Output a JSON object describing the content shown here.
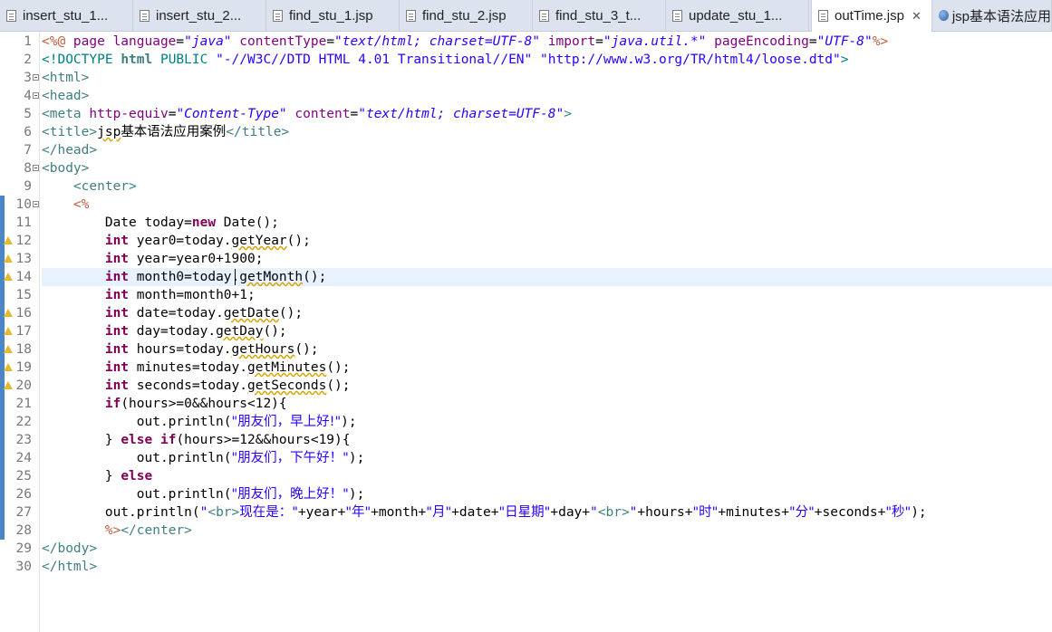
{
  "tabs": [
    {
      "label": "insert_stu_1...",
      "active": false,
      "icon": "file-icon"
    },
    {
      "label": "insert_stu_2...",
      "active": false,
      "icon": "file-icon"
    },
    {
      "label": "find_stu_1.jsp",
      "active": false,
      "icon": "file-icon"
    },
    {
      "label": "find_stu_2.jsp",
      "active": false,
      "icon": "file-icon"
    },
    {
      "label": "find_stu_3_t...",
      "active": false,
      "icon": "file-icon"
    },
    {
      "label": "update_stu_1...",
      "active": false,
      "icon": "file-icon"
    },
    {
      "label": "outTime.jsp",
      "active": true,
      "icon": "file-icon",
      "close": "✕"
    },
    {
      "label": "jsp基本语法应用",
      "active": false,
      "icon": "globe-icon"
    }
  ],
  "editor": {
    "current_line": 14,
    "lines": [
      {
        "n": "1",
        "tokens": [
          [
            "jsp",
            "<%@ "
          ],
          [
            "attr",
            "page "
          ],
          [
            "attr",
            "language"
          ],
          [
            "t",
            "="
          ],
          [
            "val",
            "\"java\""
          ],
          [
            "t",
            " "
          ],
          [
            "attr",
            "contentType"
          ],
          [
            "t",
            "="
          ],
          [
            "val",
            "\"text/html; charset=UTF-8\""
          ],
          [
            "t",
            " "
          ],
          [
            "attr",
            "import"
          ],
          [
            "t",
            "="
          ],
          [
            "val",
            "\"java.util.*\""
          ],
          [
            "t",
            " "
          ],
          [
            "attr",
            "pageEncoding"
          ],
          [
            "t",
            "="
          ],
          [
            "val",
            "\"UTF-8\""
          ],
          [
            "jsp",
            "%>"
          ]
        ]
      },
      {
        "n": "2",
        "tokens": [
          [
            "dt",
            "<!DOCTYPE "
          ],
          [
            "kw2",
            "html"
          ],
          [
            "dt",
            " PUBLIC "
          ],
          [
            "str",
            "\"-//W3C//DTD HTML 4.01 Transitional//EN\""
          ],
          [
            "t",
            " "
          ],
          [
            "str",
            "\"http://www.w3.org/TR/html4/loose.dtd\""
          ],
          [
            "dt",
            ">"
          ]
        ]
      },
      {
        "n": "3",
        "tokens": [
          [
            "tag",
            "<html>"
          ]
        ]
      },
      {
        "n": "4",
        "tokens": [
          [
            "tag",
            "<head>"
          ]
        ]
      },
      {
        "n": "5",
        "tokens": [
          [
            "tag",
            "<meta "
          ],
          [
            "attr",
            "http-equiv"
          ],
          [
            "t",
            "="
          ],
          [
            "val",
            "\"Content-Type\""
          ],
          [
            "t",
            " "
          ],
          [
            "attr",
            "content"
          ],
          [
            "t",
            "="
          ],
          [
            "val",
            "\"text/html; charset=UTF-8\""
          ],
          [
            "tag",
            ">"
          ]
        ]
      },
      {
        "n": "6",
        "tokens": [
          [
            "tag",
            "<title>"
          ],
          [
            "uw",
            "jsp"
          ],
          [
            "t",
            "基本语法应用案例"
          ],
          [
            "tag",
            "</title>"
          ]
        ]
      },
      {
        "n": "7",
        "tokens": [
          [
            "tag",
            "</head>"
          ]
        ]
      },
      {
        "n": "8",
        "tokens": [
          [
            "tag",
            "<body>"
          ]
        ]
      },
      {
        "n": "9",
        "tokens": [
          [
            "t",
            "    "
          ],
          [
            "tag",
            "<center>"
          ]
        ]
      },
      {
        "n": "10",
        "tokens": [
          [
            "t",
            "    "
          ],
          [
            "jsp",
            "<%"
          ]
        ]
      },
      {
        "n": "11",
        "tokens": [
          [
            "t",
            "        Date today="
          ],
          [
            "kw",
            "new"
          ],
          [
            "t",
            " Date();"
          ]
        ]
      },
      {
        "n": "12",
        "tokens": [
          [
            "t",
            "        "
          ],
          [
            "kw",
            "int"
          ],
          [
            "t",
            " year0=today."
          ],
          [
            "uw",
            "getYear"
          ],
          [
            "t",
            "();"
          ]
        ]
      },
      {
        "n": "13",
        "tokens": [
          [
            "t",
            "        "
          ],
          [
            "kw",
            "int"
          ],
          [
            "t",
            " year=year0+1900;"
          ]
        ]
      },
      {
        "n": "14",
        "tokens": [
          [
            "t",
            "        "
          ],
          [
            "kw",
            "int"
          ],
          [
            "t",
            " month0=today."
          ],
          [
            "uw",
            "getMonth"
          ],
          [
            "t",
            "();"
          ]
        ]
      },
      {
        "n": "15",
        "tokens": [
          [
            "t",
            "        "
          ],
          [
            "kw",
            "int"
          ],
          [
            "t",
            " month=month0+1;"
          ]
        ]
      },
      {
        "n": "16",
        "tokens": [
          [
            "t",
            "        "
          ],
          [
            "kw",
            "int"
          ],
          [
            "t",
            " date=today."
          ],
          [
            "uw",
            "getDate"
          ],
          [
            "t",
            "();"
          ]
        ]
      },
      {
        "n": "17",
        "tokens": [
          [
            "t",
            "        "
          ],
          [
            "kw",
            "int"
          ],
          [
            "t",
            " day=today."
          ],
          [
            "uw",
            "getDay"
          ],
          [
            "t",
            "();"
          ]
        ]
      },
      {
        "n": "18",
        "tokens": [
          [
            "t",
            "        "
          ],
          [
            "kw",
            "int"
          ],
          [
            "t",
            " hours=today."
          ],
          [
            "uw",
            "getHours"
          ],
          [
            "t",
            "();"
          ]
        ]
      },
      {
        "n": "19",
        "tokens": [
          [
            "t",
            "        "
          ],
          [
            "kw",
            "int"
          ],
          [
            "t",
            " minutes=today."
          ],
          [
            "uw",
            "getMinutes"
          ],
          [
            "t",
            "();"
          ]
        ]
      },
      {
        "n": "20",
        "tokens": [
          [
            "t",
            "        "
          ],
          [
            "kw",
            "int"
          ],
          [
            "t",
            " seconds=today."
          ],
          [
            "uw",
            "getSeconds"
          ],
          [
            "t",
            "();"
          ]
        ]
      },
      {
        "n": "21",
        "tokens": [
          [
            "t",
            "        "
          ],
          [
            "kw",
            "if"
          ],
          [
            "t",
            "(hours>=0&&hours<12){"
          ]
        ]
      },
      {
        "n": "22",
        "tokens": [
          [
            "t",
            "            out.println("
          ],
          [
            "str",
            "\"朋友们，早上好!\""
          ],
          [
            "t",
            ");"
          ]
        ]
      },
      {
        "n": "23",
        "tokens": [
          [
            "t",
            "        } "
          ],
          [
            "kw",
            "else"
          ],
          [
            "t",
            " "
          ],
          [
            "kw",
            "if"
          ],
          [
            "t",
            "(hours>=12&&hours<19){"
          ]
        ]
      },
      {
        "n": "24",
        "tokens": [
          [
            "t",
            "            out.println("
          ],
          [
            "str",
            "\"朋友们，下午好！\""
          ],
          [
            "t",
            ");"
          ]
        ]
      },
      {
        "n": "25",
        "tokens": [
          [
            "t",
            "        } "
          ],
          [
            "kw",
            "else"
          ]
        ]
      },
      {
        "n": "26",
        "tokens": [
          [
            "t",
            "            out.println("
          ],
          [
            "str",
            "\"朋友们，晚上好！\""
          ],
          [
            "t",
            ");"
          ]
        ]
      },
      {
        "n": "27",
        "tokens": [
          [
            "t",
            "        out.println("
          ],
          [
            "str",
            "\""
          ],
          [
            "tag",
            "<br>"
          ],
          [
            "str",
            "现在是：\""
          ],
          [
            "t",
            "+year+"
          ],
          [
            "str",
            "\"年\""
          ],
          [
            "t",
            "+month+"
          ],
          [
            "str",
            "\"月\""
          ],
          [
            "t",
            "+date+"
          ],
          [
            "str",
            "\"日星期\""
          ],
          [
            "t",
            "+day+"
          ],
          [
            "str",
            "\""
          ],
          [
            "tag",
            "<br>"
          ],
          [
            "str",
            "\""
          ],
          [
            "t",
            "+hours+"
          ],
          [
            "str",
            "\"时\""
          ],
          [
            "t",
            "+minutes+"
          ],
          [
            "str",
            "\"分\""
          ],
          [
            "t",
            "+seconds+"
          ],
          [
            "str",
            "\"秒\""
          ],
          [
            "t",
            ");"
          ]
        ]
      },
      {
        "n": "28",
        "tokens": [
          [
            "t",
            "        "
          ],
          [
            "jsp",
            "%>"
          ],
          [
            "tag",
            "</center>"
          ]
        ]
      },
      {
        "n": "29",
        "tokens": [
          [
            "tag",
            "</body>"
          ]
        ]
      },
      {
        "n": "30",
        "tokens": [
          [
            "tag",
            "</html>"
          ]
        ]
      }
    ],
    "folds": [
      "3",
      "4",
      "8",
      "10"
    ],
    "warnings": [
      "12",
      "13",
      "14",
      "16",
      "17",
      "18",
      "19",
      "20"
    ],
    "change_marks": [
      "10",
      "11",
      "12",
      "13",
      "14",
      "15",
      "16",
      "17",
      "18",
      "19",
      "20",
      "21",
      "22",
      "23",
      "24",
      "25",
      "26",
      "27",
      "28"
    ]
  }
}
